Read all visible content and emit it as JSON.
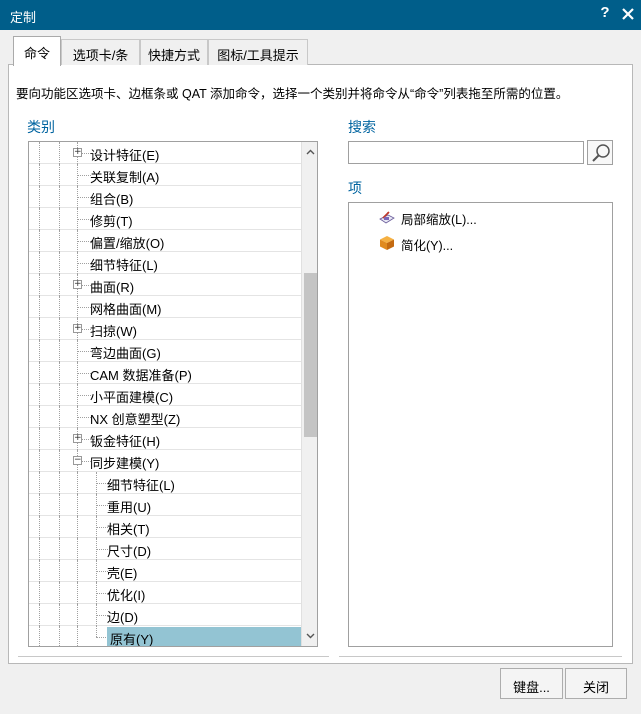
{
  "window": {
    "title": "定制",
    "help_label": "?",
    "close_label": "✕"
  },
  "tabs": [
    {
      "label": "命令",
      "active": true
    },
    {
      "label": "选项卡/条",
      "active": false
    },
    {
      "label": "快捷方式",
      "active": false
    },
    {
      "label": "图标/工具提示",
      "active": false
    }
  ],
  "instruction": "要向功能区选项卡、边框条或 QAT 添加命令，选择一个类别并将命令从“命令”列表拖至所需的位置。",
  "categories": {
    "label": "类别",
    "items": [
      {
        "label": "设计特征(E)",
        "level": 1,
        "expander": "+"
      },
      {
        "label": "关联复制(A)",
        "level": 1,
        "expander": ""
      },
      {
        "label": "组合(B)",
        "level": 1,
        "expander": ""
      },
      {
        "label": "修剪(T)",
        "level": 1,
        "expander": ""
      },
      {
        "label": "偏置/缩放(O)",
        "level": 1,
        "expander": ""
      },
      {
        "label": "细节特征(L)",
        "level": 1,
        "expander": ""
      },
      {
        "label": "曲面(R)",
        "level": 1,
        "expander": "+"
      },
      {
        "label": "网格曲面(M)",
        "level": 1,
        "expander": ""
      },
      {
        "label": "扫掠(W)",
        "level": 1,
        "expander": "+"
      },
      {
        "label": "弯边曲面(G)",
        "level": 1,
        "expander": ""
      },
      {
        "label": "CAM 数据准备(P)",
        "level": 1,
        "expander": ""
      },
      {
        "label": "小平面建模(C)",
        "level": 1,
        "expander": ""
      },
      {
        "label": "NX 创意塑型(Z)",
        "level": 1,
        "expander": ""
      },
      {
        "label": "钣金特征(H)",
        "level": 1,
        "expander": "+"
      },
      {
        "label": "同步建模(Y)",
        "level": 1,
        "expander": "−"
      },
      {
        "label": "细节特征(L)",
        "level": 2,
        "expander": ""
      },
      {
        "label": "重用(U)",
        "level": 2,
        "expander": ""
      },
      {
        "label": "相关(T)",
        "level": 2,
        "expander": ""
      },
      {
        "label": "尺寸(D)",
        "level": 2,
        "expander": ""
      },
      {
        "label": "壳(E)",
        "level": 2,
        "expander": ""
      },
      {
        "label": "优化(I)",
        "level": 2,
        "expander": ""
      },
      {
        "label": "边(D)",
        "level": 2,
        "expander": ""
      },
      {
        "label": "原有(Y)",
        "level": 2,
        "expander": "",
        "selected": true
      }
    ]
  },
  "search": {
    "label": "搜索",
    "value": "",
    "placeholder": ""
  },
  "items": {
    "label": "项",
    "list": [
      {
        "label": "局部缩放(L)...",
        "icon": "zoom-region-icon"
      },
      {
        "label": "简化(Y)...",
        "icon": "simplify-icon"
      }
    ]
  },
  "buttons": {
    "keyboard": "键盘...",
    "close": "关闭"
  }
}
